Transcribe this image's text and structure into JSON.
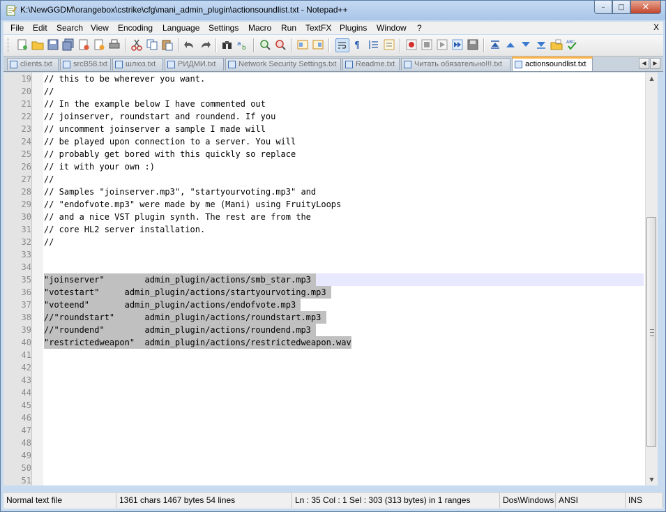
{
  "window": {
    "title": "K:\\NewGGDM\\orangebox\\cstrike\\cfg\\mani_admin_plugin\\actionsoundlist.txt - Notepad++",
    "close_glyph": "✕",
    "maximize_glyph": "□",
    "minimize_glyph": "–"
  },
  "menu": {
    "items": [
      "File",
      "Edit",
      "Search",
      "View",
      "Encoding",
      "Language",
      "Settings",
      "Macro",
      "Run",
      "TextFX",
      "Plugins",
      "Window",
      "?"
    ],
    "close_label": "X"
  },
  "toolbar": {
    "icons": [
      "new-file-icon",
      "open-file-icon",
      "save-icon",
      "save-all-icon",
      "close-icon",
      "close-all-icon",
      "print-icon",
      "cut-icon",
      "copy-icon",
      "paste-icon",
      "undo-icon",
      "redo-icon",
      "find-icon",
      "replace-icon",
      "zoom-in-icon",
      "zoom-out-icon",
      "sync-v-icon",
      "sync-h-icon",
      "word-wrap-icon",
      "show-all-chars-icon",
      "indent-guide-icon",
      "fold-icon",
      "record-macro-icon",
      "stop-macro-icon",
      "play-macro-icon",
      "run-macro-icon",
      "save-macro-icon",
      "trim-icon",
      "up-icon",
      "down-icon",
      "open-folder-icon",
      "spellcheck-icon"
    ]
  },
  "tabs": [
    {
      "label": "clients.txt",
      "active": false
    },
    {
      "label": "srcB58.txt",
      "active": false
    },
    {
      "label": "шлюз.txt",
      "active": false
    },
    {
      "label": "РИДМИ.txt",
      "active": false
    },
    {
      "label": "Network Security Settings.txt",
      "active": false
    },
    {
      "label": "Readme.txt",
      "active": false
    },
    {
      "label": "Читать обязательно!!!.txt",
      "active": false
    },
    {
      "label": "actionsoundlist.txt",
      "active": true
    }
  ],
  "tab_nav": {
    "left": "◀",
    "right": "▶"
  },
  "editor": {
    "lines": [
      {
        "n": "19",
        "text": "// this to be wherever you want.",
        "sel": false
      },
      {
        "n": "20",
        "text": "//",
        "sel": false
      },
      {
        "n": "21",
        "text": "// In the example below I have commented out",
        "sel": false
      },
      {
        "n": "22",
        "text": "// joinserver, roundstart and roundend. If you",
        "sel": false
      },
      {
        "n": "23",
        "text": "// uncomment joinserver a sample I made will",
        "sel": false
      },
      {
        "n": "24",
        "text": "// be played upon connection to a server. You will",
        "sel": false
      },
      {
        "n": "25",
        "text": "// probably get bored with this quickly so replace",
        "sel": false
      },
      {
        "n": "26",
        "text": "// it with your own :)",
        "sel": false
      },
      {
        "n": "27",
        "text": "//",
        "sel": false
      },
      {
        "n": "28",
        "text": "// Samples \"joinserver.mp3\", \"startyourvoting.mp3\" and",
        "sel": false
      },
      {
        "n": "29",
        "text": "// \"endofvote.mp3\" were made by me (Mani) using FruityLoops",
        "sel": false
      },
      {
        "n": "30",
        "text": "// and a nice VST plugin synth. The rest are from the",
        "sel": false
      },
      {
        "n": "31",
        "text": "// core HL2 server installation.",
        "sel": false
      },
      {
        "n": "32",
        "text": "//",
        "sel": false
      },
      {
        "n": "33",
        "text": "",
        "sel": false
      },
      {
        "n": "34",
        "text": "",
        "sel": false
      },
      {
        "n": "35",
        "text": "\"joinserver\"        admin_plugin/actions/smb_star.mp3 ",
        "sel": true
      },
      {
        "n": "36",
        "text": "\"votestart\"     admin_plugin/actions/startyourvoting.mp3 ",
        "sel": true
      },
      {
        "n": "37",
        "text": "\"voteend\"       admin_plugin/actions/endofvote.mp3 ",
        "sel": true
      },
      {
        "n": "38",
        "text": "//\"roundstart\"      admin_plugin/actions/roundstart.mp3 ",
        "sel": true
      },
      {
        "n": "39",
        "text": "//\"roundend\"        admin_plugin/actions/roundend.mp3 ",
        "sel": true
      },
      {
        "n": "40",
        "text": "\"restrictedweapon\"  admin_plugin/actions/restrictedweapon.wav",
        "sel": true
      },
      {
        "n": "41",
        "text": "",
        "sel": false
      },
      {
        "n": "42",
        "text": "",
        "sel": false
      },
      {
        "n": "43",
        "text": "",
        "sel": false
      },
      {
        "n": "44",
        "text": "",
        "sel": false
      },
      {
        "n": "45",
        "text": "",
        "sel": false
      },
      {
        "n": "46",
        "text": "",
        "sel": false
      },
      {
        "n": "47",
        "text": "",
        "sel": false
      },
      {
        "n": "48",
        "text": "",
        "sel": false
      },
      {
        "n": "49",
        "text": "",
        "sel": false
      },
      {
        "n": "50",
        "text": "",
        "sel": false
      },
      {
        "n": "51",
        "text": "",
        "sel": false
      }
    ],
    "current_line": "35"
  },
  "scrollbar": {
    "up": "▲",
    "down": "▼"
  },
  "status": {
    "file_type": "Normal text file",
    "size": "1361 chars  1467 bytes  54 lines",
    "position": "Ln : 35    Col : 1    Sel : 303 (313 bytes) in 1 ranges",
    "eol": "Dos\\Windows",
    "encoding": "ANSI",
    "mode": "INS"
  },
  "colors": {
    "selection": "#c0c0c0",
    "current_line": "#e8e8ff",
    "active_tab_accent": "#ffb347"
  }
}
